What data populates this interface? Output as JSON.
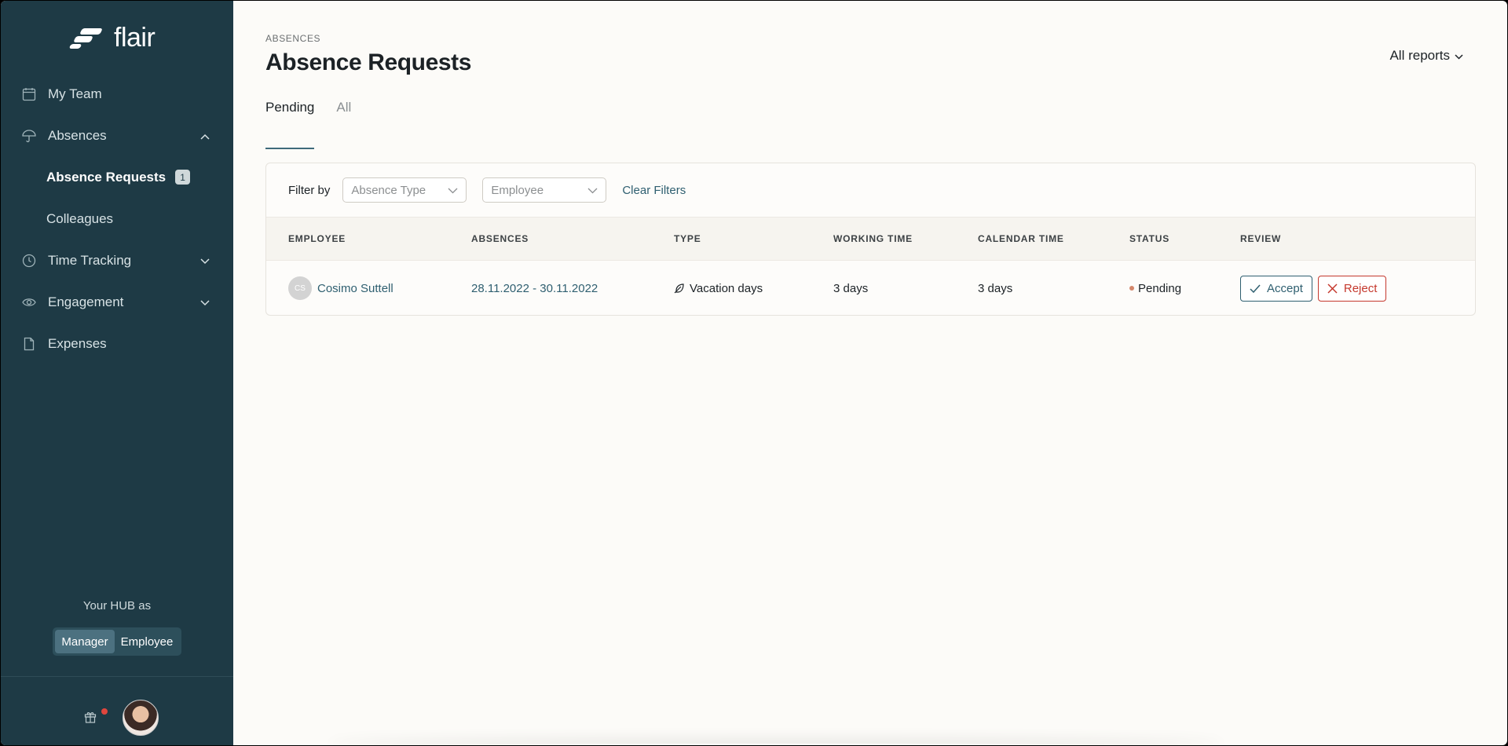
{
  "brand": {
    "name": "flair"
  },
  "sidebar": {
    "items": [
      {
        "label": "My Team",
        "icon": "calendar-icon"
      },
      {
        "label": "Absences",
        "icon": "umbrella-icon"
      },
      {
        "label": "Absence Requests",
        "badge": "1"
      },
      {
        "label": "Colleagues"
      },
      {
        "label": "Time Tracking",
        "icon": "clock-icon"
      },
      {
        "label": "Engagement",
        "icon": "eye-icon"
      },
      {
        "label": "Expenses",
        "icon": "document-icon"
      }
    ],
    "hub_label": "Your HUB as",
    "hub_options": [
      "Manager",
      "Employee"
    ],
    "hub_selected": "Manager"
  },
  "header": {
    "breadcrumb": "ABSENCES",
    "title": "Absence Requests",
    "reports_label": "All reports"
  },
  "tabs": [
    {
      "label": "Pending",
      "active": true
    },
    {
      "label": "All",
      "active": false
    }
  ],
  "filters": {
    "label": "Filter by",
    "absence_type_placeholder": "Absence Type",
    "employee_placeholder": "Employee",
    "clear_label": "Clear Filters"
  },
  "table": {
    "columns": [
      "EMPLOYEE",
      "ABSENCES",
      "TYPE",
      "WORKING TIME",
      "CALENDAR TIME",
      "STATUS",
      "REVIEW"
    ],
    "rows": [
      {
        "initials": "CS",
        "employee": "Cosimo Suttell",
        "absences": "28.11.2022 - 30.11.2022",
        "type": "Vacation days",
        "working_time": "3 days",
        "calendar_time": "3 days",
        "status": "Pending",
        "accept_label": "Accept",
        "reject_label": "Reject"
      }
    ]
  },
  "colors": {
    "sidebar_bg": "#1e3a45",
    "accent": "#2f5f70",
    "reject": "#c5392e",
    "pending_dot": "#d4876b"
  }
}
